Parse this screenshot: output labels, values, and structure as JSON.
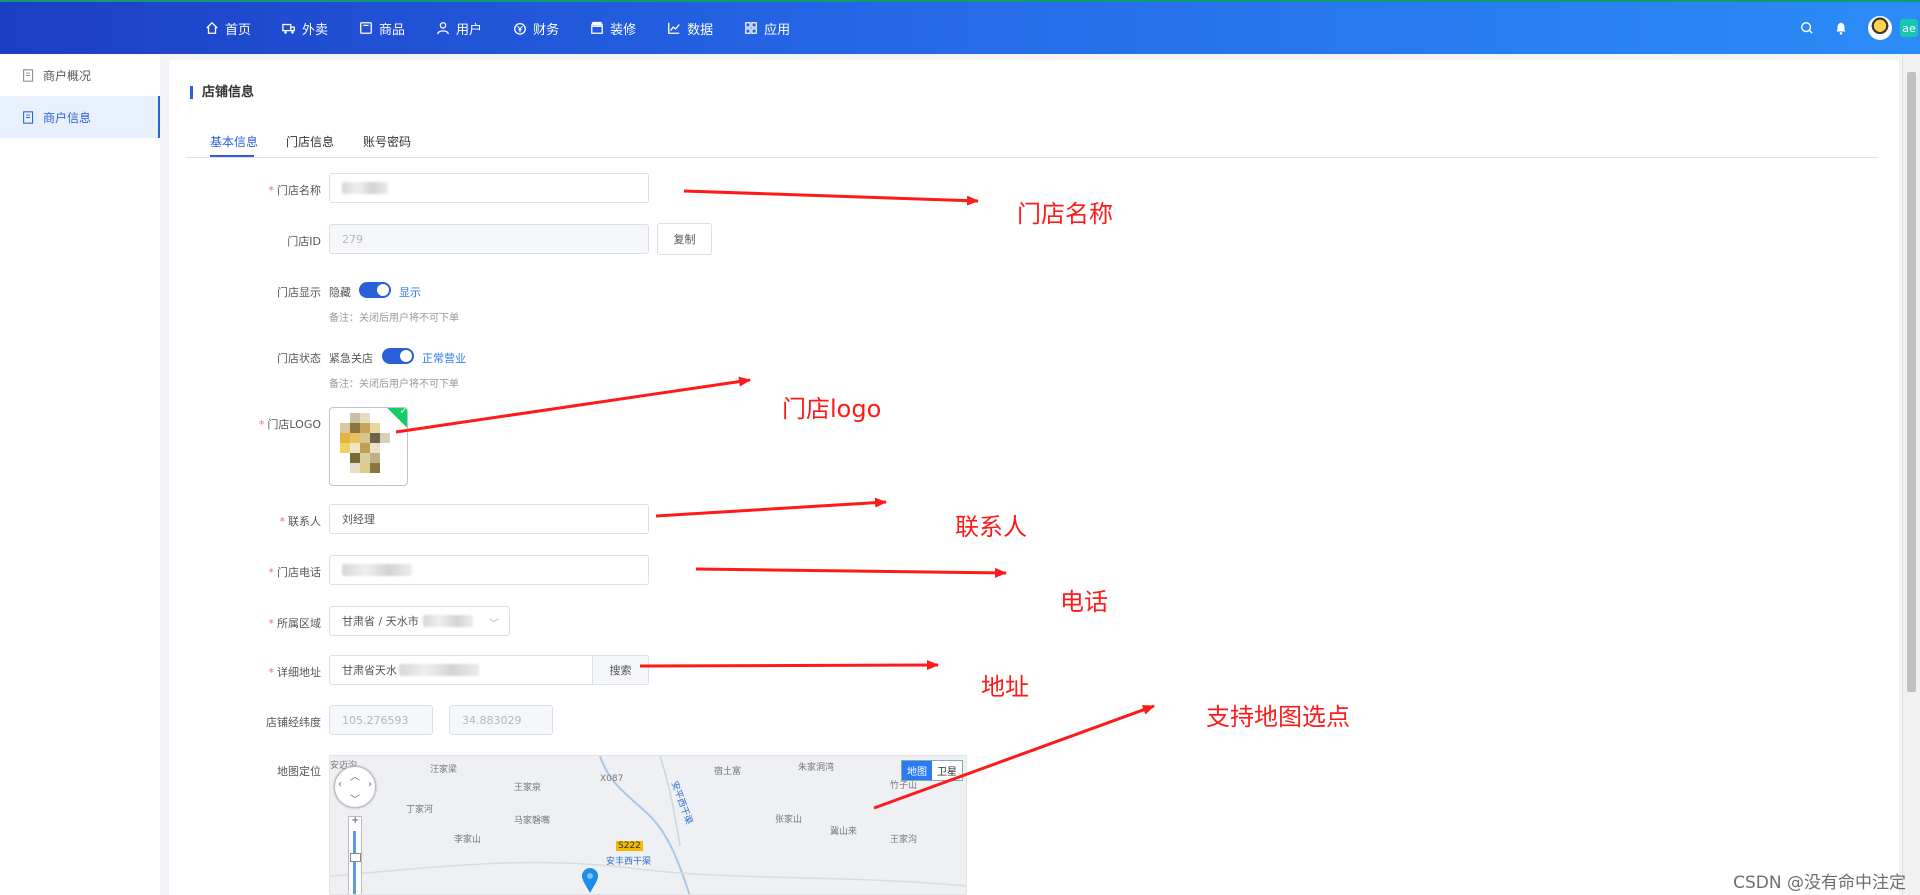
{
  "topnav": {
    "items": [
      {
        "label": "首页",
        "icon": "home-icon"
      },
      {
        "label": "外卖",
        "icon": "delivery-icon"
      },
      {
        "label": "商品",
        "icon": "goods-icon"
      },
      {
        "label": "用户",
        "icon": "user-icon"
      },
      {
        "label": "财务",
        "icon": "finance-icon"
      },
      {
        "label": "装修",
        "icon": "store-decor-icon"
      },
      {
        "label": "数据",
        "icon": "chart-icon"
      },
      {
        "label": "应用",
        "icon": "apps-icon"
      }
    ],
    "right_icons": [
      "search-icon",
      "bell-icon",
      "avatar",
      "app-badge"
    ],
    "app_badge_text": "ae"
  },
  "sidebar": {
    "items": [
      {
        "label": "商户概况",
        "active": false
      },
      {
        "label": "商户信息",
        "active": true
      }
    ]
  },
  "section": {
    "title": "店铺信息"
  },
  "tabs": [
    {
      "label": "基本信息",
      "active": true
    },
    {
      "label": "门店信息",
      "active": false
    },
    {
      "label": "账号密码",
      "active": false
    }
  ],
  "form": {
    "store_name": {
      "label": "门店名称",
      "required": true
    },
    "store_id": {
      "label": "门店ID",
      "value": "279",
      "copy_label": "复制"
    },
    "store_display": {
      "label": "门店显示",
      "off_text": "隐藏",
      "on_text": "显示",
      "note": "备注：关闭后用户将不可下单"
    },
    "store_status": {
      "label": "门店状态",
      "off_text": "紧急关店",
      "on_text": "正常营业",
      "note": "备注：关闭后用户将不可下单"
    },
    "store_logo": {
      "label": "门店LOGO",
      "required": true
    },
    "contact": {
      "label": "联系人",
      "required": true,
      "value": "刘经理"
    },
    "phone": {
      "label": "门店电话",
      "required": true
    },
    "region": {
      "label": "所属区域",
      "required": true,
      "value": "甘肃省 / 天水市"
    },
    "address": {
      "label": "详细地址",
      "required": true,
      "value": "甘肃省天水",
      "search_label": "搜索"
    },
    "coords": {
      "label": "店铺经纬度",
      "longitude": "105.276593",
      "latitude": "34.883029"
    },
    "map": {
      "label": "地图定位",
      "type_map": "地图",
      "type_satellite": "卫星"
    }
  },
  "map_places": [
    "汪家梁",
    "王家泉",
    "丁家河",
    "马家磐嘴",
    "李家山",
    "X087",
    "宿土富",
    "朱家洞湾",
    "张家山",
    "冀山来",
    "王家沟",
    "竹子山",
    "S222",
    "安丰西干渠",
    "安平西干渠"
  ],
  "annotations": {
    "store_name": "门店名称",
    "store_logo": "门店logo",
    "contact": "联系人",
    "phone": "电话",
    "address": "地址",
    "map": "支持地图选点"
  },
  "watermark": "CSDN @没有命中注定",
  "colors": {
    "primary": "#2b5fd9",
    "annotation": "#ff1a1a",
    "topbar_start": "#1c3ec4",
    "topbar_end": "#2b8cf7"
  }
}
